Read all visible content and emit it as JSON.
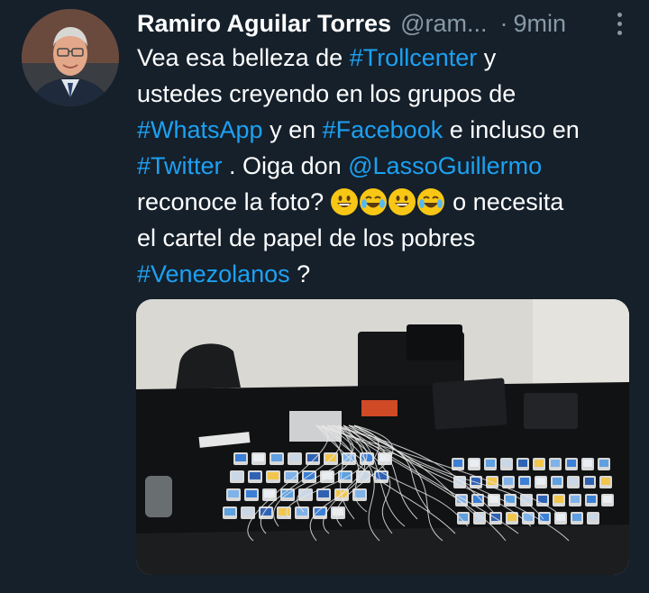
{
  "tweet": {
    "author_name": "Ramiro Aguilar Torres",
    "author_handle": "@ram...",
    "separator": "·",
    "time": "9min",
    "text_lines": [
      [
        {
          "t": "Vea esa belleza de "
        },
        {
          "t": "#Trollcenter",
          "link": true
        },
        {
          "t": " y"
        }
      ],
      [
        {
          "t": "ustedes creyendo en los grupos de"
        }
      ],
      [
        {
          "t": "#WhatsApp",
          "link": true
        },
        {
          "t": " y en "
        },
        {
          "t": "#Facebook",
          "link": true
        },
        {
          "t": " e incluso en"
        }
      ],
      [
        {
          "t": "#Twitter",
          "link": true
        },
        {
          "t": " . Oiga don "
        },
        {
          "t": "@LassoGuillermo",
          "link": true
        }
      ],
      [
        {
          "t": "reconoce la foto? "
        },
        {
          "emoji": "grinning-face"
        },
        {
          "emoji": "tears-of-joy"
        },
        {
          "emoji": "grinning-face"
        },
        {
          "emoji": "tears-of-joy"
        },
        {
          "t": " o necesita"
        }
      ],
      [
        {
          "t": "el cartel de papel de los pobres"
        }
      ],
      [
        {
          "t": "#Venezolanos",
          "link": true
        },
        {
          "t": " ?"
        }
      ]
    ]
  },
  "media": {
    "description_icon": "photo",
    "phones_per_row_left": [
      9,
      9,
      8,
      7
    ],
    "phones_per_row_right": [
      10,
      10,
      10,
      9
    ]
  },
  "colors": {
    "background": "#15202b",
    "text": "#ffffff",
    "link": "#1da1f2",
    "secondary": "#8899a6"
  }
}
